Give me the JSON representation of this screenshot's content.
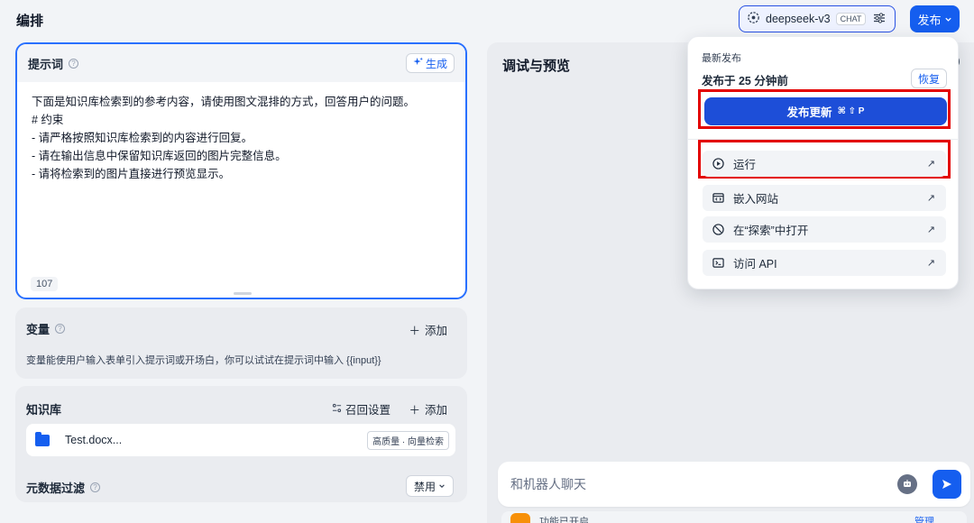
{
  "header": {
    "title": "编排",
    "model_name": "deepseek-v3",
    "model_tag": "CHAT",
    "publish_label": "发布"
  },
  "prompt": {
    "title": "提示词",
    "generate_label": "生成",
    "lines": [
      "下面是知识库检索到的参考内容，请使用图文混排的方式，回答用户的问题。",
      "# 约束",
      "- 请严格按照知识库检索到的内容进行回复。",
      "- 请在输出信息中保留知识库返回的图片完整信息。",
      "- 请将检索到的图片直接进行预览显示。"
    ],
    "char_count": "107"
  },
  "variables": {
    "title": "变量",
    "add_label": "添加",
    "description": "变量能使用户输入表单引入提示词或开场白，你可以试试在提示词中输入 {{input}}"
  },
  "knowledge": {
    "title": "知识库",
    "recall_label": "召回设置",
    "add_label": "添加",
    "item_name": "Test.docx...",
    "item_badge": "高质量 · 向量检索",
    "meta_filter_title": "元数据过滤",
    "meta_filter_value": "禁用"
  },
  "preview": {
    "title": "调试与预览",
    "chat_placeholder": "和机器人聊天",
    "feature_text": "功能已开启",
    "manage_label": "管理"
  },
  "dropdown": {
    "latest_label": "最新发布",
    "published_time": "发布于 25 分钟前",
    "restore_label": "恢复",
    "update_label": "发布更新",
    "shortcut": "⌘ ⇧ P",
    "items": [
      {
        "label": "运行"
      },
      {
        "label": "嵌入网站"
      },
      {
        "label": "在“探索”中打开"
      },
      {
        "label": "访问 API"
      }
    ]
  },
  "colors": {
    "accent": "#155eef",
    "highlight": "#e30000"
  }
}
